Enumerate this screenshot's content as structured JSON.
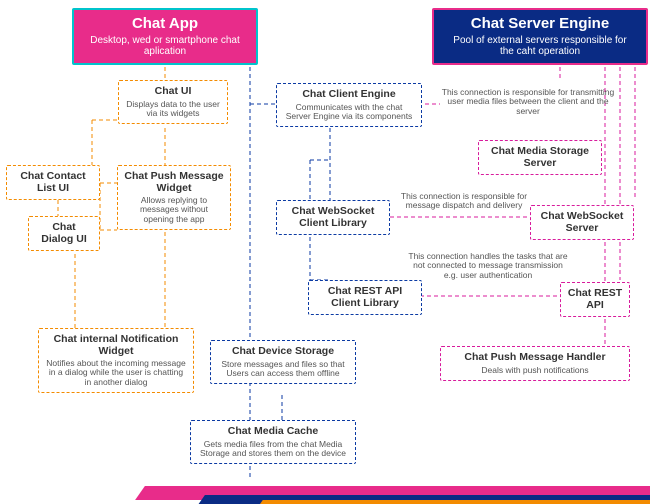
{
  "headers": {
    "app": {
      "title": "Chat App",
      "sub": "Desktop, wed or smartphone chat aplication"
    },
    "server": {
      "title": "Chat Server Engine",
      "sub": "Pool of external servers responsible for the caht operation"
    }
  },
  "boxes": {
    "chatUI": {
      "t": "Chat UI",
      "s": "Displays data to the user via its widgets"
    },
    "contactList": {
      "t": "Chat Contact List UI",
      "s": ""
    },
    "pushWidget": {
      "t": "Chat Push Message Widget",
      "s": "Allows replying to messages without opening the app"
    },
    "dialogUI": {
      "t": "Chat Dialog UI",
      "s": ""
    },
    "internalNotif": {
      "t": "Chat internal Notification Widget",
      "s": "Notifies about the incoming message in a dialog while the user is chatting in another dialog"
    },
    "clientEngine": {
      "t": "Chat Client Engine",
      "s": "Communicates with the chat Server Engine via its components"
    },
    "wsClient": {
      "t": "Chat WebSocket Client Library",
      "s": ""
    },
    "restClient": {
      "t": "Chat REST API Client Library",
      "s": ""
    },
    "deviceStorage": {
      "t": "Chat Device Storage",
      "s": "Store messages and files so that Users can access them offline"
    },
    "mediaCache": {
      "t": "Chat Media Cache",
      "s": "Gets media files from the chat Media Storage and stores them on the device"
    },
    "mediaStorage": {
      "t": "Chat Media Storage Server",
      "s": ""
    },
    "wsServer": {
      "t": "Chat WebSocket Server",
      "s": ""
    },
    "restApi": {
      "t": "Chat REST API",
      "s": ""
    },
    "pushHandler": {
      "t": "Chat Push Message Handler",
      "s": "Deals with push notifications"
    }
  },
  "notes": {
    "n1": "This connection is responsible for transmitting user media files between the client and the server",
    "n2": "This connection is responsible for message dispatch and delivery",
    "n3": "This connection handles the tasks that are not connected to message transmission e.g. user authentication"
  }
}
